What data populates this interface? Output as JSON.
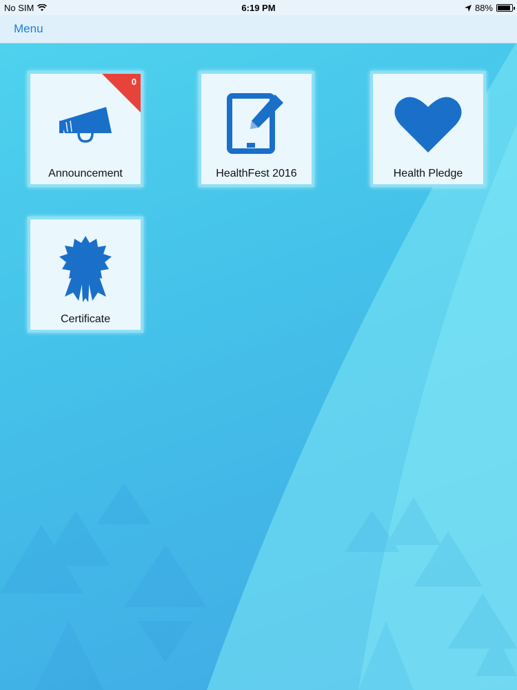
{
  "status_bar": {
    "carrier": "No SIM",
    "time": "6:19 PM",
    "battery": "88%",
    "battery_level": 0.88
  },
  "nav": {
    "menu_label": "Menu"
  },
  "tiles": [
    {
      "label": "Announcement",
      "icon": "megaphone-icon",
      "badge": "0"
    },
    {
      "label": "HealthFest 2016",
      "icon": "tablet-pencil-icon"
    },
    {
      "label": "Health Pledge",
      "icon": "heart-icon"
    },
    {
      "label": "Certificate",
      "icon": "award-ribbon-icon"
    }
  ],
  "colors": {
    "icon_blue": "#1a6fc9",
    "badge_red": "#e8433a",
    "menu_blue": "#1d7fd0"
  }
}
